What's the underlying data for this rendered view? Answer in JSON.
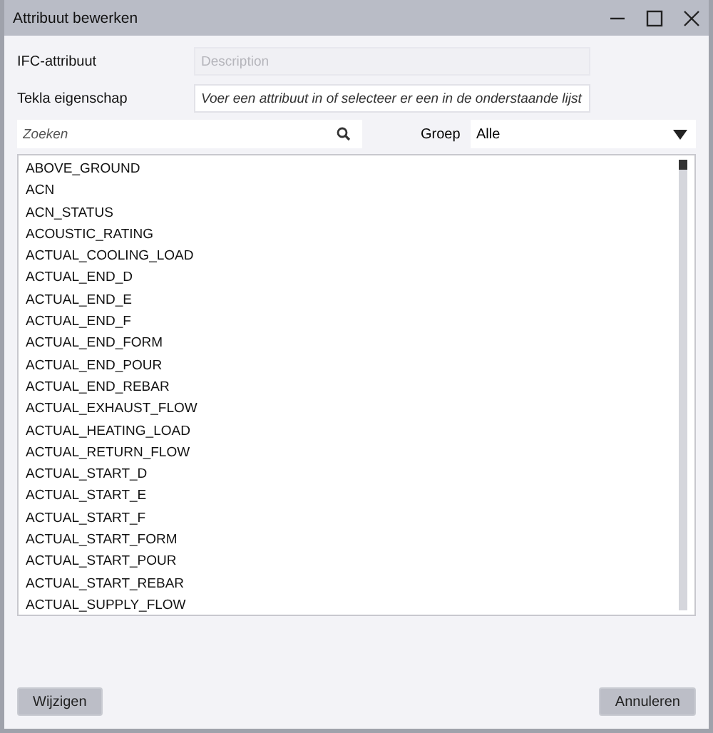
{
  "window": {
    "title": "Attribuut bewerken"
  },
  "fields": [
    {
      "label": "IFC-attribuut",
      "value": "Description",
      "disabled": true
    },
    {
      "label": "Tekla eigenschap",
      "placeholder": "Voer een attribuut in of selecteer er een in de onderstaande lijst",
      "disabled": false
    }
  ],
  "search": {
    "placeholder": "Zoeken"
  },
  "group": {
    "label": "Groep",
    "value": "Alle"
  },
  "list": {
    "items": [
      "ABOVE_GROUND",
      "ACN",
      "ACN_STATUS",
      "ACOUSTIC_RATING",
      "ACTUAL_COOLING_LOAD",
      "ACTUAL_END_D",
      "ACTUAL_END_E",
      "ACTUAL_END_F",
      "ACTUAL_END_FORM",
      "ACTUAL_END_POUR",
      "ACTUAL_END_REBAR",
      "ACTUAL_EXHAUST_FLOW",
      "ACTUAL_HEATING_LOAD",
      "ACTUAL_RETURN_FLOW",
      "ACTUAL_START_D",
      "ACTUAL_START_E",
      "ACTUAL_START_F",
      "ACTUAL_START_FORM",
      "ACTUAL_START_POUR",
      "ACTUAL_START_REBAR",
      "ACTUAL_SUPPLY_FLOW"
    ]
  },
  "buttons": [
    "Wijzigen",
    "Annuleren"
  ]
}
